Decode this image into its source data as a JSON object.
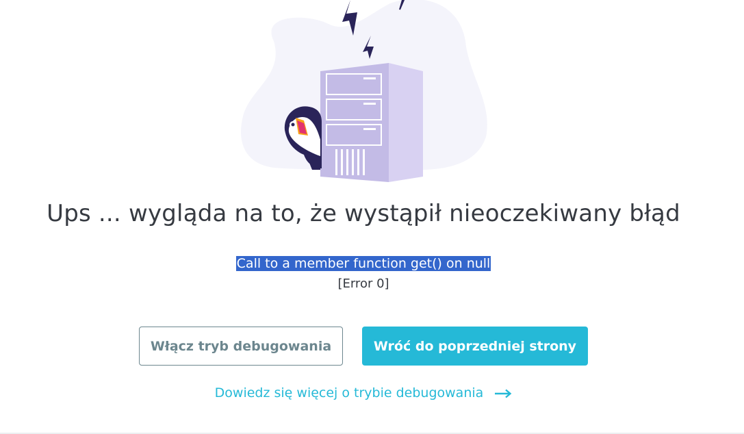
{
  "error_page": {
    "title": "Ups ... wygląda na to, że wystąpił nieoczekiwany błąd",
    "message": "Call to a member function get() on null",
    "code": "[Error 0]"
  },
  "actions": {
    "debug_label": "Włącz tryb debugowania",
    "back_label": "Wróć do poprzedniej strony",
    "learn_more_label": "Dowiedz się więcej o trybie debugowania"
  },
  "colors": {
    "primary": "#25b9d7",
    "secondary": "#6c868e",
    "text": "#363a41",
    "selection": "#3366cc",
    "illustration_blob": "#f4f4fb",
    "server": "#c3bbe6",
    "bolt": "#2a2459"
  },
  "icons": {
    "illustration": "server-puffin-illustration",
    "link_arrow": "arrow-right-icon"
  }
}
